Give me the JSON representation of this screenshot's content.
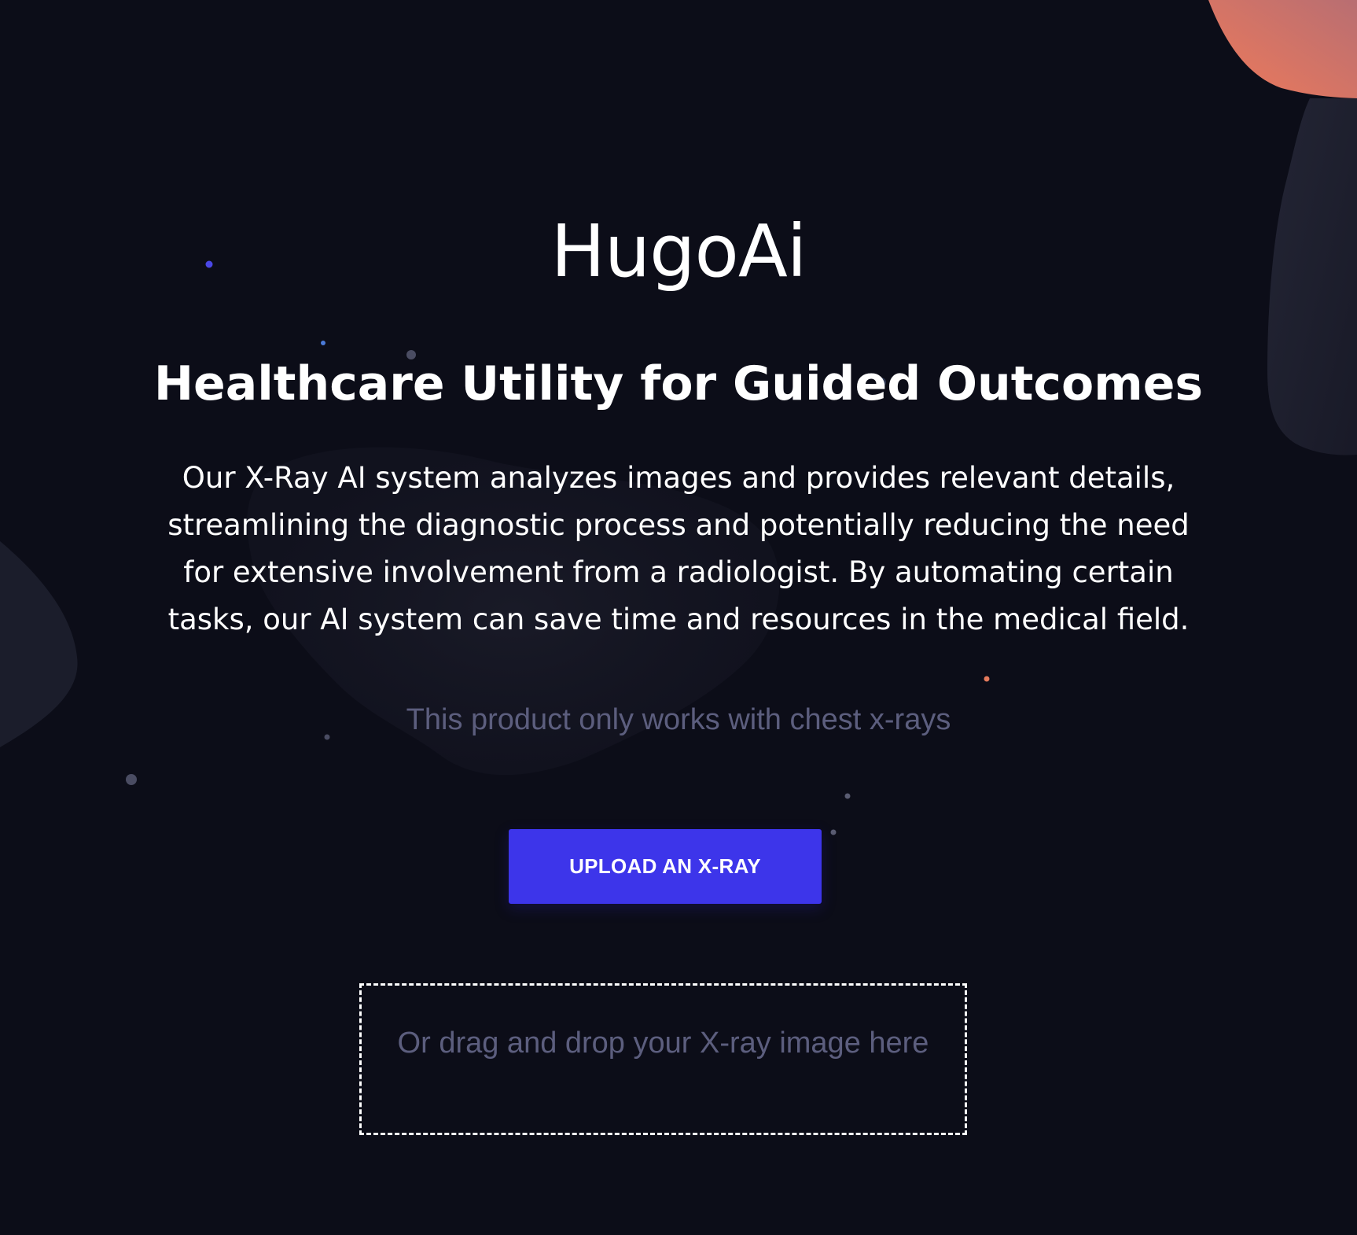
{
  "page": {
    "app_title": "HugoAi",
    "subtitle": "Healthcare Utility for Guided Outcomes",
    "description": "Our X-Ray AI system analyzes images and provides relevant details, streamlining the diagnostic process and potentially reducing the need for extensive involvement from a radiologist. By automating certain tasks, our AI system can save time and resources in the medical field.",
    "note": "This product only works with chest x-rays",
    "upload_button_label": "UPLOAD AN X-RAY",
    "dropzone_text": "Or drag and drop your X-ray image here"
  },
  "colors": {
    "background": "#0c0d18",
    "accent": "#3d35ea",
    "muted_text": "#5c5e7e",
    "blob_orange": "#e57a5c",
    "blob_dark": "#1d1f2e"
  },
  "icons": {
    "decorations": [
      "blob-shape",
      "particle-dot"
    ]
  }
}
